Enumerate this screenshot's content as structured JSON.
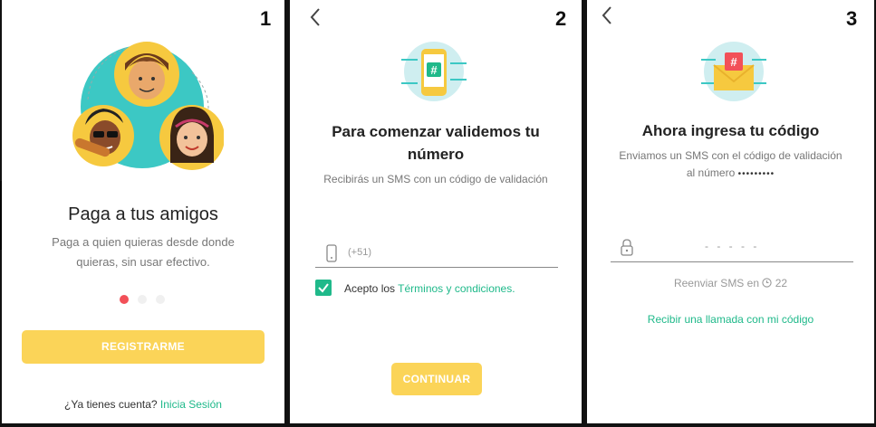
{
  "colors": {
    "accent": "#1fb98a",
    "yellow": "#fbd458",
    "dot_active": "#f25058",
    "dot_inactive": "#f0f0f0",
    "teal": "#3cc8c4"
  },
  "screen1": {
    "step": "1",
    "title": "Paga a tus amigos",
    "desc_line1": "Paga a quien quieras desde donde",
    "desc_line2": "quieras, sin usar efectivo.",
    "register_button": "REGISTRARME",
    "have_account": "¿Ya tienes cuenta?",
    "login_link": "Inicia Sesión",
    "carousel": {
      "total": 3,
      "active": 1
    }
  },
  "screen2": {
    "step": "2",
    "title_line1": "Para comenzar validemos tu",
    "title_line2": "número",
    "subtitle": "Recibirás un SMS con un código de validación",
    "phone_placeholder": "(+51)",
    "terms_prefix": "Acepto los",
    "terms_link": "Términos y condiciones.",
    "terms_checked": true,
    "continue_button": "CONTINUAR"
  },
  "screen3": {
    "step": "3",
    "title": "Ahora ingresa tu código",
    "desc_line1": "Enviamos un SMS con el código de validación",
    "desc_line2_prefix": "al número",
    "masked_number": "•••••••••",
    "code_placeholder": "- - - - -",
    "resend_label": "Reenviar SMS en",
    "resend_seconds": "22",
    "call_link": "Recibir una llamada con mi código"
  }
}
